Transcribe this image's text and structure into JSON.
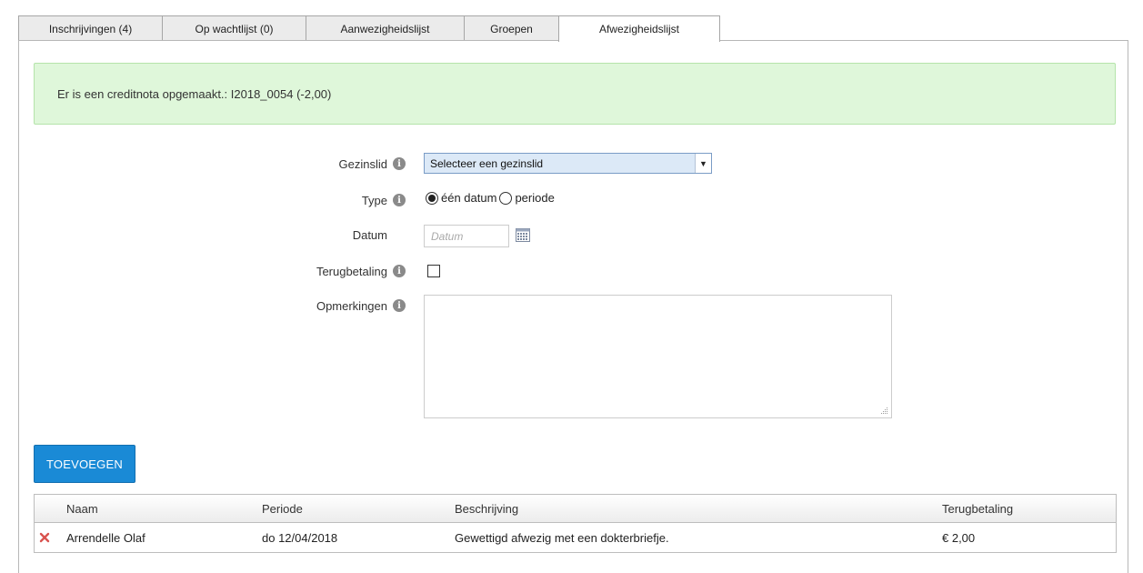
{
  "tabs": [
    {
      "label": "Inschrijvingen (4)"
    },
    {
      "label": "Op wachtlijst (0)"
    },
    {
      "label": "Aanwezigheidslijst"
    },
    {
      "label": "Groepen"
    },
    {
      "label": "Afwezigheidslijst",
      "active": true
    }
  ],
  "alert": {
    "message": "Er is een creditnota opgemaakt.: I2018_0054 (-2,00)",
    "bg_color": "#dff7da",
    "border_color": "#b5e4aa"
  },
  "form": {
    "gezinslid": {
      "label": "Gezinslid",
      "selected": "Selecteer een gezinslid"
    },
    "type": {
      "label": "Type",
      "option_single": "één datum",
      "option_period": "periode",
      "selected": "één datum"
    },
    "datum": {
      "label": "Datum",
      "placeholder": "Datum"
    },
    "terugbetaling": {
      "label": "Terugbetaling",
      "checked": false
    },
    "opmerkingen": {
      "label": "Opmerkingen",
      "value": ""
    }
  },
  "add_button": {
    "label": "TOEVOEGEN",
    "color": "#1a8ad6"
  },
  "table": {
    "columns": [
      "Naam",
      "Periode",
      "Beschrijving",
      "Terugbetaling"
    ],
    "rows": [
      {
        "naam": "Arrendelle Olaf",
        "periode": "do 12/04/2018",
        "beschrijving": "Gewettigd afwezig met een dokterbriefje.",
        "terugbetaling": "€ 2,00"
      }
    ]
  },
  "icons": {
    "info": "info-icon",
    "calendar": "calendar-icon",
    "delete": "delete-icon",
    "dropdown": "chevron-down-icon"
  }
}
